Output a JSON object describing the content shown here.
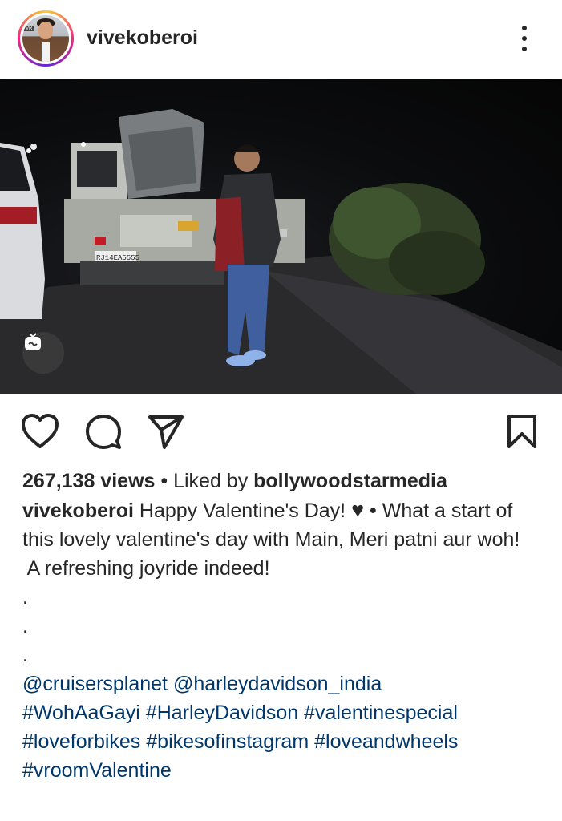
{
  "post": {
    "username": "vivekoberoi",
    "avatar_tag": "VR"
  },
  "media": {
    "plate_text": "RJ14EA5555",
    "igtv_icon": "igtv-icon"
  },
  "actions": {
    "like_icon": "heart-icon",
    "comment_icon": "comment-icon",
    "share_icon": "send-icon",
    "save_icon": "bookmark-icon"
  },
  "stats": {
    "views": "267,138 views",
    "separator": " • ",
    "liked_by_prefix": "Liked by ",
    "liked_by_user": "bollywoodstarmedia"
  },
  "caption": {
    "username": "vivekoberoi",
    "text1": " Happy Valentine's Day! ",
    "heart": "♥",
    "text2": " • What a start of this lovely valentine's day with Main, Meri patni aur woh!",
    "line2": " A refreshing joyride indeed!",
    "dot1": ".",
    "dot2": ".",
    "dot3": ".",
    "mention1": "@cruisersplanet",
    "mention2": "@harleydavidson_india",
    "tag1": "#WohAaGayi",
    "tag2": "#HarleyDavidson",
    "tag3": "#valentinespecial",
    "tag4": "#loveforbikes",
    "tag5": "#bikesofinstagram",
    "tag6": "#loveandwheels",
    "tag7": "#vroomValentine"
  },
  "colors": {
    "text": "#262626",
    "link": "#00376b",
    "story_ring_start": "#f9ce34",
    "story_ring_mid": "#ee2a7b"
  }
}
